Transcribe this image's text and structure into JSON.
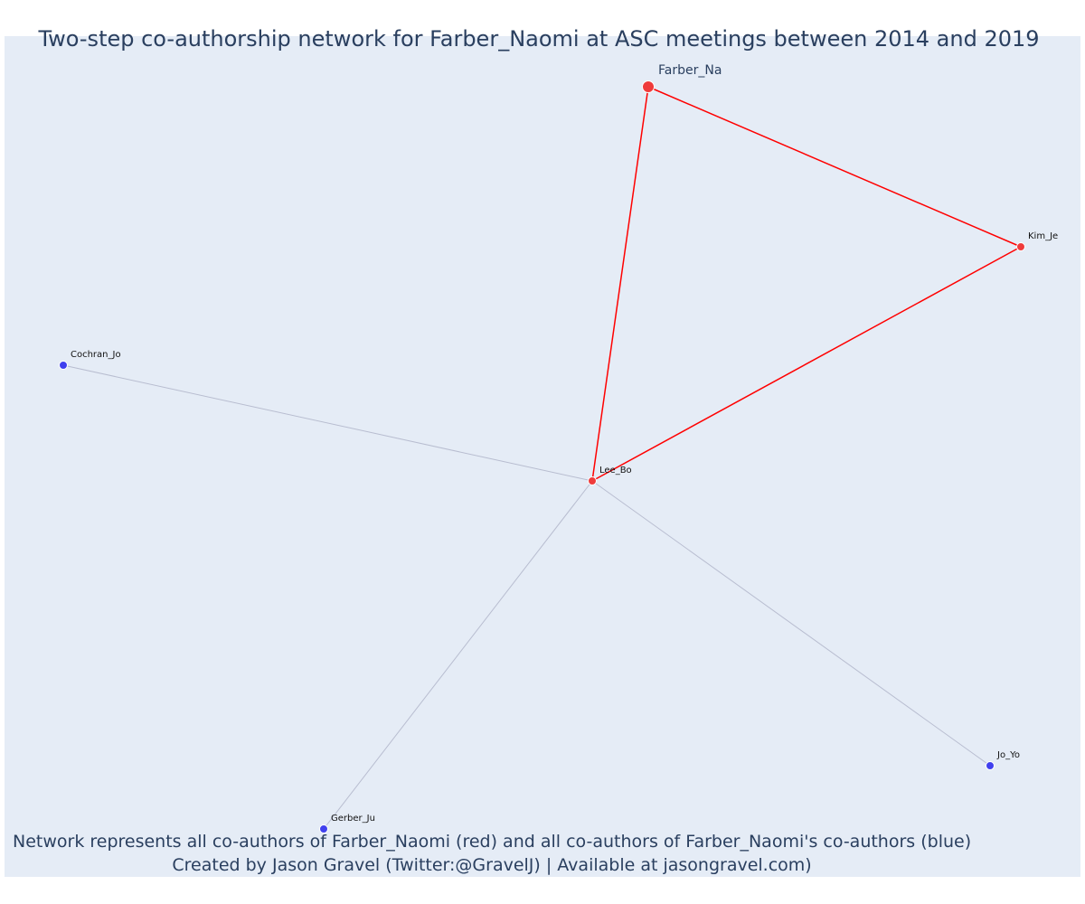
{
  "title": "Two-step co-authorship network for Farber_Naomi at ASC meetings between 2014 and 2019",
  "caption": {
    "line1": "Network represents all co-authors of Farber_Naomi (red) and all co-authors of Farber_Naomi's co-authors (blue)",
    "line2": "Created by Jason Gravel (Twitter:@GravelJ) | Available at jasongravel.com)"
  },
  "colors": {
    "background": "#e5ecf6",
    "coauthor_node": "#ef3b3b",
    "second_step_node": "#4040ee",
    "coauthor_edge": "#ff0000",
    "second_step_edge": "#b8bdd0",
    "text": "#2a3f5f"
  },
  "chart_data": {
    "type": "network",
    "nodes": [
      {
        "id": "Farber_Na",
        "label": "Farber_Na",
        "group": "focal"
      },
      {
        "id": "Kim_Je",
        "label": "Kim_Je",
        "group": "coauthor"
      },
      {
        "id": "Lee_Bo",
        "label": "Lee_Bo",
        "group": "coauthor"
      },
      {
        "id": "Cochran_Jo",
        "label": "Cochran_Jo",
        "group": "second_step"
      },
      {
        "id": "Gerber_Ju",
        "label": "Gerber_Ju",
        "group": "second_step"
      },
      {
        "id": "Jo_Yo",
        "label": "Jo_Yo",
        "group": "second_step"
      }
    ],
    "edges": [
      {
        "source": "Farber_Na",
        "target": "Kim_Je",
        "type": "coauthor"
      },
      {
        "source": "Farber_Na",
        "target": "Lee_Bo",
        "type": "coauthor"
      },
      {
        "source": "Kim_Je",
        "target": "Lee_Bo",
        "type": "coauthor"
      },
      {
        "source": "Lee_Bo",
        "target": "Cochran_Jo",
        "type": "second_step"
      },
      {
        "source": "Lee_Bo",
        "target": "Gerber_Ju",
        "type": "second_step"
      },
      {
        "source": "Lee_Bo",
        "target": "Jo_Yo",
        "type": "second_step"
      }
    ]
  }
}
